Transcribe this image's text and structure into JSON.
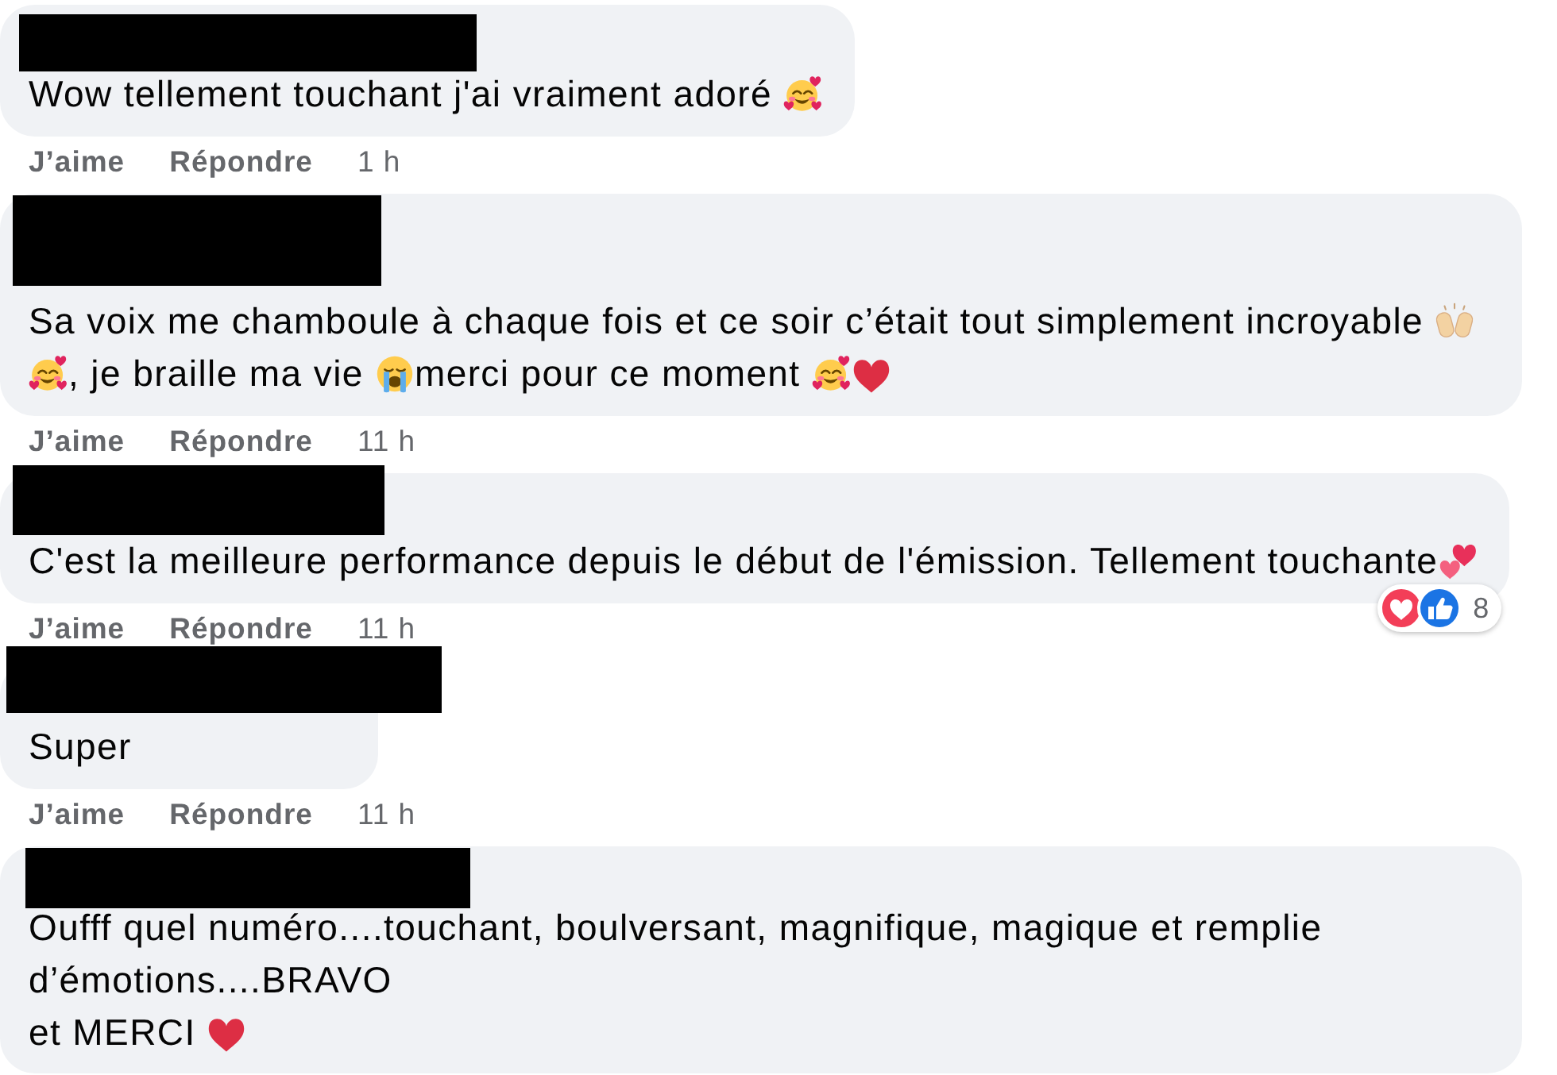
{
  "comments": [
    {
      "name_redacted": true,
      "text": [
        {
          "kind": "text",
          "text": "Wow tellement touchant j'ai vraiment adoré "
        },
        {
          "kind": "smiling-hearts"
        }
      ],
      "actions": {
        "like": "J’aime",
        "reply": "Répondre",
        "time": "1 h"
      }
    },
    {
      "name_redacted": true,
      "text": [
        {
          "kind": "text",
          "text": "Sa voix me chamboule à chaque fois et ce soir c’était tout simplement incroyable "
        },
        {
          "kind": "raised-hands"
        },
        {
          "kind": "smiling-hearts"
        },
        {
          "kind": "text",
          "text": ", je braille ma vie "
        },
        {
          "kind": "crying"
        },
        {
          "kind": "text",
          "text": "merci pour ce moment "
        },
        {
          "kind": "smiling-hearts"
        },
        {
          "kind": "red-heart"
        }
      ],
      "actions": {
        "like": "J’aime",
        "reply": "Répondre",
        "time": "11 h"
      }
    },
    {
      "name_redacted": true,
      "text": [
        {
          "kind": "text",
          "text": "C'est la meilleure performance depuis le début de l'émission. Tellement touchante"
        },
        {
          "kind": "two-hearts"
        }
      ],
      "reactions": {
        "items": [
          {
            "kind": "heart"
          },
          {
            "kind": "like"
          }
        ],
        "count": "8"
      },
      "actions": {
        "like": "J’aime",
        "reply": "Répondre",
        "time": "11 h"
      }
    },
    {
      "name_redacted": true,
      "text": [
        {
          "kind": "text",
          "text": "Super"
        }
      ],
      "actions": {
        "like": "J’aime",
        "reply": "Répondre",
        "time": "11 h"
      }
    },
    {
      "name_redacted": true,
      "text": [
        {
          "kind": "text",
          "text": "Oufff quel numéro....touchant, boulversant, magnifique, magique et remplie d’émotions....BRAVO\net MERCI "
        },
        {
          "kind": "red-heart"
        }
      ]
    }
  ]
}
